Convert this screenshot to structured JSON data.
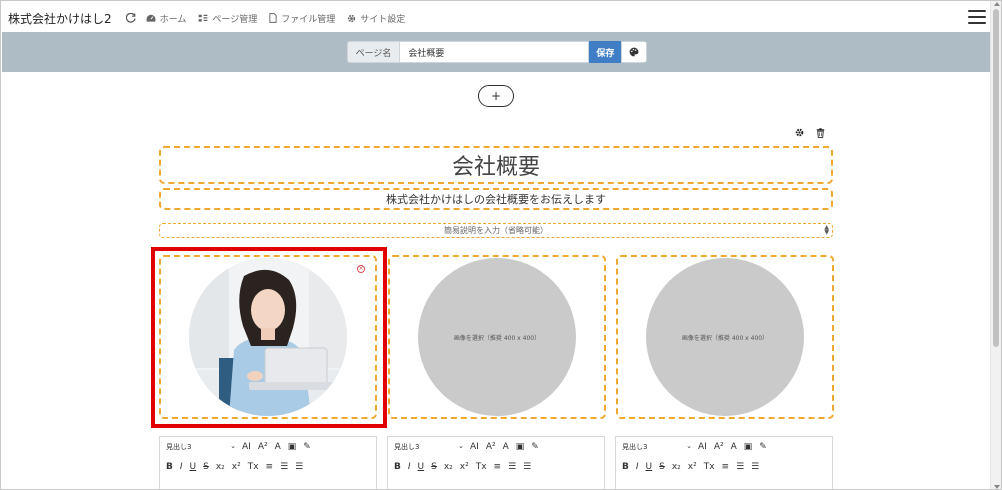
{
  "app": {
    "brand": "株式会社かけはし2"
  },
  "nav": {
    "items": [
      {
        "label": "ホーム",
        "icon": "dashboard-icon"
      },
      {
        "label": "ページ管理",
        "icon": "sitemap-icon"
      },
      {
        "label": "ファイル管理",
        "icon": "file-icon"
      },
      {
        "label": "サイト設定",
        "icon": "gear-icon"
      }
    ]
  },
  "pagebar": {
    "label": "ページ名",
    "value": "会社概要",
    "save_label": "保存"
  },
  "add_block": {
    "label": "+"
  },
  "block": {
    "title": "会社概要",
    "subtitle": "株式会社かけはしの会社概要をお伝えします",
    "description_placeholder": "簡易説明を入力（省略可能）",
    "image_placeholder": "画像を選択（推奨 400 x 400）",
    "images": [
      {
        "state": "photo",
        "name": "person-photo"
      },
      {
        "state": "empty"
      },
      {
        "state": "empty"
      }
    ]
  },
  "editor": {
    "heading_select": "見出し3",
    "row1": [
      "AI",
      "A²",
      "A",
      "▣",
      "✎"
    ],
    "row2": [
      "B",
      "I",
      "U",
      "S",
      "x₂",
      "x²",
      "Tx",
      "≡",
      "☰",
      "☰"
    ]
  },
  "colors": {
    "accent": "#3f7ec4",
    "pagebar_bg": "#aebcc5",
    "dashed_border": "#f0a830",
    "highlight": "#e00000"
  }
}
